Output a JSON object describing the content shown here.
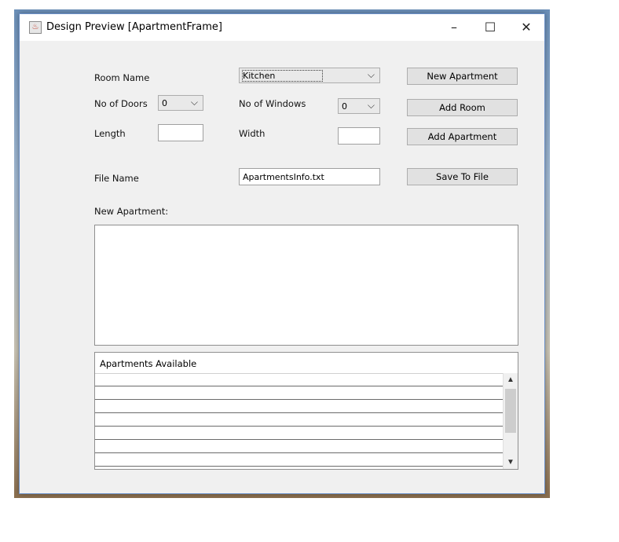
{
  "window": {
    "title": "Design Preview [ApartmentFrame]",
    "controls": {
      "minimize": "–",
      "maximize": "☐",
      "close": "✕"
    }
  },
  "form": {
    "room_name_label": "Room Name",
    "room_name_value": "Kitchen",
    "doors_label": "No of Doors",
    "doors_value": "0",
    "windows_label": "No of Windows",
    "windows_value": "0",
    "length_label": "Length",
    "length_value": "",
    "width_label": "Width",
    "width_value": "",
    "file_name_label": "File Name",
    "file_name_value": "ApartmentsInfo.txt",
    "new_apartment_label": "New Apartment:"
  },
  "buttons": {
    "new_apartment": "New Apartment",
    "add_room": "Add Room",
    "add_apartment": "Add Apartment",
    "save_to_file": "Save To File"
  },
  "table": {
    "header": "Apartments Available",
    "rows": [
      "",
      "",
      "",
      "",
      "",
      "",
      ""
    ]
  },
  "icons": {
    "app": "java-cup-icon",
    "dropdown": "chevron-down-icon",
    "scroll_up": "chevron-up-icon",
    "scroll_down": "chevron-down-icon"
  },
  "colors": {
    "window_bg": "#f0f0f0",
    "button_bg": "#e1e1e1",
    "border": "#adadad"
  }
}
